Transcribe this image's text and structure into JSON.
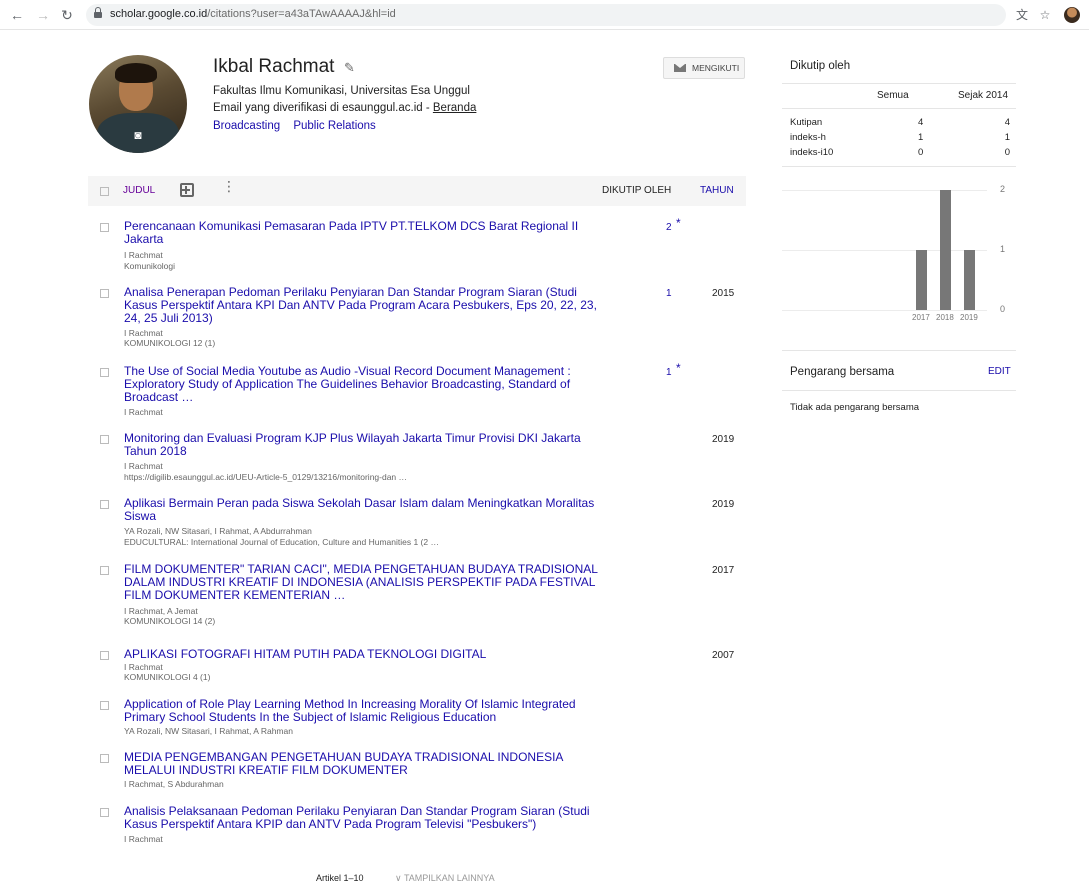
{
  "browser": {
    "url_host": "scholar.google.co.id",
    "url_path": "/citations?user=a43aTAwAAAAJ&hl=id"
  },
  "profile": {
    "name": "Ikbal Rachmat",
    "affiliation": "Fakultas Ilmu Komunikasi, Universitas Esa Unggul",
    "email_text": "Email yang diverifikasi di esaunggul.ac.id - ",
    "homepage_label": "Beranda",
    "interests": [
      "Broadcasting",
      "Public Relations"
    ],
    "follow_label": "MENGIKUTI"
  },
  "table": {
    "title_header": "JUDUL",
    "cited_header": "DIKUTIP OLEH",
    "year_header": "TAHUN"
  },
  "articles": [
    {
      "title": "Perencanaan Komunikasi Pemasaran Pada IPTV PT.TELKOM DCS Barat Regional II Jakarta",
      "authors": "I Rachmat",
      "venue": "Komunikologi",
      "cited": "2",
      "star": "*",
      "year": ""
    },
    {
      "title": "Analisa Penerapan Pedoman Perilaku Penyiaran Dan Standar Program Siaran (Studi Kasus Perspektif Antara KPI Dan ANTV Pada Program Acara Pesbukers, Eps 20, 22, 23, 24, 25 Juli 2013)",
      "authors": "I Rachmat",
      "venue": "KOMUNIKOLOGI 12 (1)",
      "cited": "1",
      "star": "",
      "year": "2015"
    },
    {
      "title": "The Use of Social Media Youtube as Audio -Visual Record Document Management : Exploratory Study of Application The Guidelines Behavior Broadcasting, Standard of Broadcast …",
      "authors": "I Rachmat",
      "venue": "",
      "cited": "1",
      "star": "*",
      "year": ""
    },
    {
      "title": "Monitoring dan Evaluasi Program KJP Plus Wilayah Jakarta Timur Provisi DKI Jakarta Tahun 2018",
      "authors": "I Rachmat",
      "venue": "https://digilib.esaunggul.ac.id/UEU-Article-5_0129/13216/monitoring-dan …",
      "cited": "",
      "star": "",
      "year": "2019"
    },
    {
      "title": "Aplikasi Bermain Peran pada Siswa Sekolah Dasar Islam dalam Meningkatkan Moralitas Siswa",
      "authors": "YA Rozali, NW Sitasari, I Rahmat, A Abdurrahman",
      "venue": "EDUCULTURAL: International Journal of Education, Culture and Humanities 1 (2 …",
      "cited": "",
      "star": "",
      "year": "2019"
    },
    {
      "title": "FILM DOKUMENTER\" TARIAN CACI\", MEDIA PENGETAHUAN BUDAYA TRADISIONAL DALAM INDUSTRI KREATIF DI INDONESIA (ANALISIS PERSPEKTIF PADA FESTIVAL FILM DOKUMENTER KEMENTERIAN …",
      "authors": "I Rachmat, A Jemat",
      "venue": "KOMUNIKOLOGI 14 (2)",
      "cited": "",
      "star": "",
      "year": "2017"
    },
    {
      "title": "APLIKASI FOTOGRAFI HITAM PUTIH PADA TEKNOLOGI DIGITAL",
      "authors": "I Rachmat",
      "venue": "KOMUNIKOLOGI 4 (1)",
      "cited": "",
      "star": "",
      "year": "2007"
    },
    {
      "title": "Application of Role Play Learning Method In Increasing Morality Of Islamic Integrated Primary School Students In the Subject of Islamic Religious Education",
      "authors": "YA Rozali, NW Sitasari, I Rahmat, A Rahman",
      "venue": "",
      "cited": "",
      "star": "",
      "year": ""
    },
    {
      "title": "MEDIA PENGEMBANGAN PENGETAHUAN BUDAYA TRADISIONAL INDONESIA MELALUI INDUSTRI KREATIF FILM DOKUMENTER",
      "authors": "I Rachmat, S Abdurahman",
      "venue": "",
      "cited": "",
      "star": "",
      "year": ""
    },
    {
      "title": "Analisis Pelaksanaan Pedoman Perilaku Penyiaran Dan Standar Program Siaran (Studi Kasus Perspektif Antara KPIP dan ANTV Pada Program Televisi \"Pesbukers\")",
      "authors": "I Rachmat",
      "venue": "",
      "cited": "",
      "star": "",
      "year": ""
    }
  ],
  "footer": {
    "range": "Artikel 1–10",
    "show_more": "TAMPILKAN LAINNYA"
  },
  "cited_by": {
    "title": "Dikutip oleh",
    "col_all": "Semua",
    "col_since": "Sejak 2014",
    "rows": [
      {
        "label": "Kutipan",
        "all": "4",
        "since": "4"
      },
      {
        "label": "indeks-h",
        "all": "1",
        "since": "1"
      },
      {
        "label": "indeks-i10",
        "all": "0",
        "since": "0"
      }
    ]
  },
  "chart_data": {
    "type": "bar",
    "categories": [
      "2017",
      "2018",
      "2019"
    ],
    "values": [
      1,
      2,
      1
    ],
    "ylim": [
      0,
      2
    ],
    "yticks": [
      "0",
      "1",
      "2"
    ],
    "bar_color": "#777777"
  },
  "coauthors": {
    "title": "Pengarang bersama",
    "edit_label": "EDIT",
    "empty_text": "Tidak ada pengarang bersama"
  },
  "colors": {
    "link": "#1a0dab",
    "header_purple": "#660099"
  }
}
